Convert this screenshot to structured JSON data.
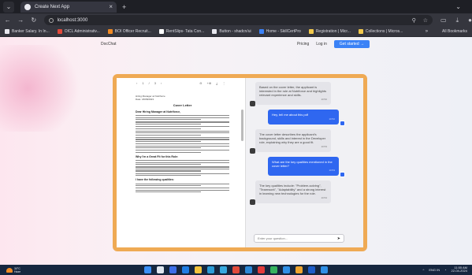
{
  "browser": {
    "tab_title": "Create Next App",
    "url": "localhost:3000",
    "new_tab_label": "+",
    "bookmarks": [
      {
        "label": "Banker Salary. In In...",
        "color": "#e7e7ee"
      },
      {
        "label": "OICL Administrativ...",
        "color": "#e24a3b"
      },
      {
        "label": "BOI Officer Recruit...",
        "color": "#f08a24"
      },
      {
        "label": "RentSlips- Tata Con...",
        "color": "#ffffff"
      },
      {
        "label": "Button - shadcn/ui",
        "color": "#e7e7ee"
      },
      {
        "label": "Home - SkillCertPro",
        "color": "#3b82f6"
      },
      {
        "label": "Registration | Micr...",
        "color": "#f2c94c"
      },
      {
        "label": "Collections | Micros...",
        "color": "#f2c94c"
      }
    ],
    "bookmarks_more": "»",
    "all_bookmarks": "All Bookmarks"
  },
  "site": {
    "brand": "DocChat",
    "nav": [
      "Pricing",
      "Log in"
    ],
    "cta": "Get started →"
  },
  "doc": {
    "toolbar": [
      "‹",
      "1",
      "/",
      "3",
      "›",
      "⊖",
      "+⊕",
      "⤓",
      "⋮"
    ],
    "header_lines": [
      "Hiring Manager at Nutriforce",
      "Date: 18/08/2023"
    ],
    "title": "Cover Letter",
    "sections": [
      {
        "heading": "Dear Hiring Manager at Nutriforce,",
        "lines": 3
      },
      {
        "heading": "",
        "lines": 2
      },
      {
        "heading": "",
        "lines": 2
      },
      {
        "heading": "",
        "lines": 3
      },
      {
        "heading": "",
        "lines": 3
      },
      {
        "heading": "",
        "lines": 3
      },
      {
        "heading": "",
        "lines": 2
      },
      {
        "heading": "Why I'm a Great Fit for this Role:",
        "lines": 3
      },
      {
        "heading": "",
        "lines": 3
      },
      {
        "heading": "",
        "lines": 2
      },
      {
        "heading": "I have the following qualities:",
        "lines": 2
      },
      {
        "heading": "",
        "lines": 3
      }
    ]
  },
  "chat": {
    "messages": [
      {
        "role": "ai",
        "text": "Based on the cover letter, the applicant is interested in the role at Nutriforce and highlights relevant experience and skills.",
        "time": "10:52"
      },
      {
        "role": "user",
        "text": "Hey, tell me about this pdf",
        "time": "10:52"
      },
      {
        "role": "ai",
        "text": "The cover letter describes the applicant's background, skills and interest in the Developer role, explaining why they are a good fit.",
        "time": "10:53"
      },
      {
        "role": "user",
        "text": "What are the key qualities mentioned in the cover letter?",
        "time": "10:53"
      },
      {
        "role": "ai",
        "text": "The key qualities include: \"Problem-solving\", \"Teamwork\", \"Adaptability\" and a strong interest in learning new technologies for the role.",
        "time": "10:54"
      }
    ],
    "input_placeholder": "Enter your question..."
  },
  "taskbar": {
    "weather_temp": "30°C",
    "weather_desc": "Haze",
    "lang": "ENG IN",
    "time": "11:55 AM",
    "date": "22-04-2024",
    "apps": [
      {
        "name": "windows",
        "color": "#3b8ff6"
      },
      {
        "name": "search",
        "color": "#dfe5ee"
      },
      {
        "name": "files",
        "color": "#3d6ee8"
      },
      {
        "name": "mail",
        "color": "#1f7ce3"
      },
      {
        "name": "explorer",
        "color": "#f3c23b"
      },
      {
        "name": "photos",
        "color": "#2b9bd7"
      },
      {
        "name": "store",
        "color": "#38a9e0"
      },
      {
        "name": "chrome",
        "color": "#e04a3b"
      },
      {
        "name": "edge",
        "color": "#2d88d8"
      },
      {
        "name": "youtube",
        "color": "#e33b3b"
      },
      {
        "name": "chrome2",
        "color": "#36b35f"
      },
      {
        "name": "vscode",
        "color": "#2f8fe6"
      },
      {
        "name": "app11",
        "color": "#f0a530"
      },
      {
        "name": "app12",
        "color": "#1e5cc8"
      },
      {
        "name": "app13",
        "color": "#2f8fe6"
      }
    ]
  }
}
